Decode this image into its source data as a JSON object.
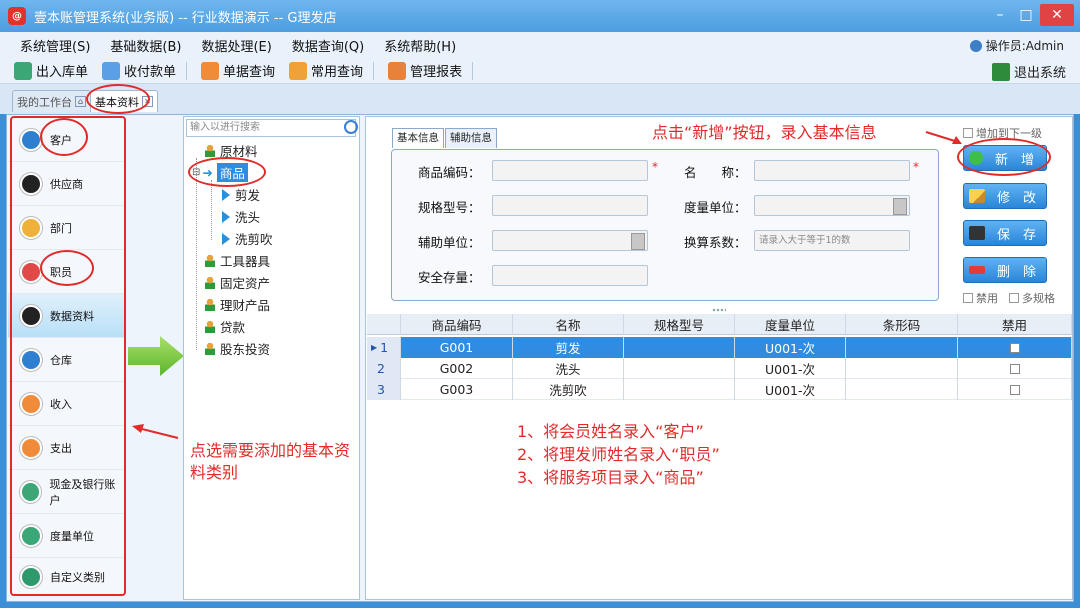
{
  "window": {
    "title": "壹本账管理系统(业务版) -- 行业数据演示 -- G理发店",
    "controls": {
      "minimize": "–",
      "maximize": "□",
      "close": "✕"
    }
  },
  "menu": {
    "items": [
      "系统管理(S)",
      "基础数据(B)",
      "数据处理(E)",
      "数据查询(Q)",
      "系统帮助(H)"
    ],
    "operator": "操作员:Admin"
  },
  "toolbar": {
    "buttons": [
      {
        "label": "出入库单",
        "icon": "stock-icon",
        "color": "#3ba776"
      },
      {
        "label": "收付款单",
        "icon": "payment-icon",
        "color": "#5aa0e6"
      },
      {
        "label": "单据查询",
        "icon": "document-query-icon",
        "color": "#f08b3a"
      },
      {
        "label": "常用查询",
        "icon": "chart-icon",
        "color": "#f0a23a"
      },
      {
        "label": "管理报表",
        "icon": "report-icon",
        "color": "#e8823a"
      }
    ],
    "exit": "退出系统"
  },
  "tabs": [
    {
      "label": "我的工作台"
    },
    {
      "label": "基本资料"
    }
  ],
  "sidebar": {
    "items": [
      {
        "label": "客户",
        "icon": "customer-icon",
        "color": "#2e7fd0"
      },
      {
        "label": "供应商",
        "icon": "supplier-icon",
        "color": "#222222"
      },
      {
        "label": "部门",
        "icon": "department-icon",
        "color": "#f0b13a"
      },
      {
        "label": "职员",
        "icon": "employee-icon",
        "color": "#e14848"
      },
      {
        "label": "数据资料",
        "icon": "data-icon",
        "color": "#222222"
      },
      {
        "label": "仓库",
        "icon": "warehouse-icon",
        "color": "#2e7fd0"
      },
      {
        "label": "收入",
        "icon": "income-icon",
        "color": "#f08b3a"
      },
      {
        "label": "支出",
        "icon": "expense-icon",
        "color": "#f08b3a"
      },
      {
        "label": "现金及银行账户",
        "icon": "cash-bank-icon",
        "color": "#3ba776"
      },
      {
        "label": "度量单位",
        "icon": "unit-icon",
        "color": "#3ba776"
      },
      {
        "label": "自定义类别",
        "icon": "custom-category-icon",
        "color": "#2e9a6b"
      }
    ]
  },
  "tree": {
    "search_placeholder": "输入以进行搜索",
    "nodes": [
      {
        "label": "原材料",
        "level": 0,
        "icon": "person"
      },
      {
        "label": "商品",
        "level": 0,
        "icon": "arrow",
        "selected": true
      },
      {
        "label": "剪发",
        "level": 1,
        "icon": "play"
      },
      {
        "label": "洗头",
        "level": 1,
        "icon": "play"
      },
      {
        "label": "洗剪吹",
        "level": 1,
        "icon": "play"
      },
      {
        "label": "工具器具",
        "level": 0,
        "icon": "person"
      },
      {
        "label": "固定资产",
        "level": 0,
        "icon": "person"
      },
      {
        "label": "理财产品",
        "level": 0,
        "icon": "person"
      },
      {
        "label": "贷款",
        "level": 0,
        "icon": "person"
      },
      {
        "label": "股东投资",
        "level": 0,
        "icon": "person"
      }
    ]
  },
  "form": {
    "tabs": [
      "基本信息",
      "辅助信息"
    ],
    "fields": {
      "code": "商品编码：",
      "name": "名　　称：",
      "spec": "规格型号：",
      "unit": "度量单位：",
      "aux_unit": "辅助单位：",
      "ratio": "换算系数：",
      "ratio_placeholder": "请录入大于等于1的数",
      "safety_stock": "安全存量："
    },
    "required_mark": "*"
  },
  "actions": {
    "add_next_level": "增加到下一级",
    "new": "新　增",
    "edit": "修　改",
    "save": "保　存",
    "delete": "删　除",
    "disabled": "禁用",
    "multi_spec": "多规格"
  },
  "grid": {
    "columns": [
      "商品编码",
      "名称",
      "规格型号",
      "度量单位",
      "条形码",
      "禁用"
    ],
    "rows": [
      {
        "num": "1",
        "code": "G001",
        "name": "剪发",
        "spec": "",
        "unit": "U001-次",
        "barcode": ""
      },
      {
        "num": "2",
        "code": "G002",
        "name": "洗头",
        "spec": "",
        "unit": "U001-次",
        "barcode": ""
      },
      {
        "num": "3",
        "code": "G003",
        "name": "洗剪吹",
        "spec": "",
        "unit": "U001-次",
        "barcode": ""
      }
    ]
  },
  "annotations": {
    "top": "点击“新增”按钮，录入基本信息",
    "left": "点选需要添加的基本资料类别",
    "steps": [
      "1、将会员姓名录入“客户”",
      "2、将理发师姓名录入“职员”",
      "3、将服务项目录入“商品”"
    ]
  },
  "colors": {
    "annotation": "#e12b2b",
    "selection": "#2f8ce0",
    "button": "#2a85d8"
  }
}
